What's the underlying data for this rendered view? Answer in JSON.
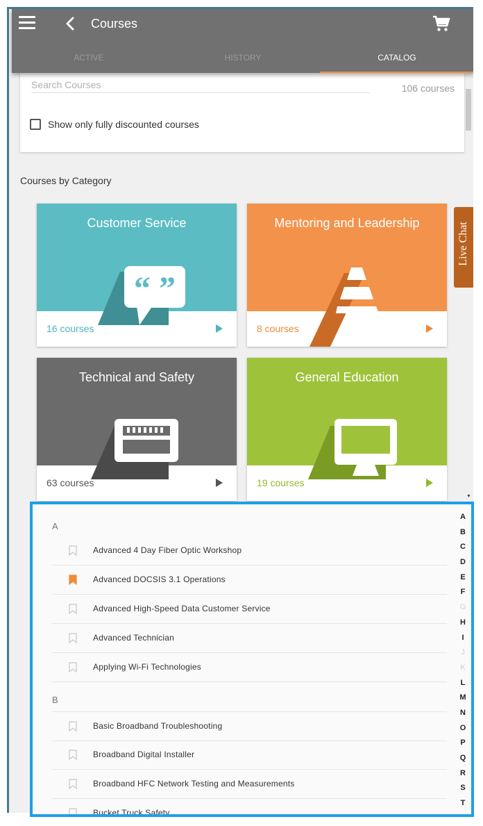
{
  "appbar": {
    "title": "Courses",
    "icons": [
      "menu-icon",
      "back-icon",
      "cart-icon"
    ],
    "tabs": [
      {
        "label": "ACTIVE",
        "active": false
      },
      {
        "label": "HISTORY",
        "active": false
      },
      {
        "label": "CATALOG",
        "active": true
      }
    ],
    "accent_color": "#f28c38"
  },
  "search": {
    "placeholder": "Search Courses",
    "value": "",
    "count_text": "106 courses",
    "discount_checkbox_label": "Show only fully discounted courses",
    "discount_checked": false
  },
  "categories": {
    "title": "Courses by Category",
    "tiles": [
      {
        "title": "Customer Service",
        "count": "16 courses",
        "color": "#5bbcc3",
        "count_color": "#4fb3bb",
        "icon": "speech-bubble-quote-icon"
      },
      {
        "title": "Mentoring and Leadership",
        "count": "8 courses",
        "color": "#f3924a",
        "count_color": "#ea8a3f",
        "icon": "pyramid-icon"
      },
      {
        "title": "Technical and Safety",
        "count": "63 courses",
        "color": "#6b6b6b",
        "count_color": "#555555",
        "icon": "circuit-board-icon"
      },
      {
        "title": "General Education",
        "count": "19 courses",
        "color": "#9ec33a",
        "count_color": "#93ba2c",
        "icon": "monitor-icon"
      }
    ]
  },
  "live_chat": {
    "label": "Live Chat",
    "color": "#b9621f"
  },
  "alphabetical": {
    "sections": [
      {
        "letter": "A",
        "items": [
          {
            "title": "Advanced 4 Day Fiber Optic Workshop",
            "bookmarked": false
          },
          {
            "title": "Advanced DOCSIS 3.1 Operations",
            "bookmarked": true
          },
          {
            "title": "Advanced High-Speed Data Customer Service",
            "bookmarked": false
          },
          {
            "title": "Advanced Technician",
            "bookmarked": false
          },
          {
            "title": "Applying Wi-Fi Technologies",
            "bookmarked": false
          }
        ]
      },
      {
        "letter": "B",
        "items": [
          {
            "title": "Basic Broadband Troubleshooting",
            "bookmarked": false
          },
          {
            "title": "Broadband Digital Installer",
            "bookmarked": false
          },
          {
            "title": "Broadband HFC Network Testing and Measurements",
            "bookmarked": false
          },
          {
            "title": "Bucket Truck Safety",
            "bookmarked": false
          }
        ]
      }
    ],
    "index_letters": [
      "A",
      "B",
      "C",
      "D",
      "E",
      "F",
      "G",
      "H",
      "I",
      "J",
      "K",
      "L",
      "M",
      "N",
      "O",
      "P",
      "Q",
      "R",
      "S",
      "T"
    ],
    "disabled_letters": [
      "G",
      "J",
      "K"
    ],
    "bookmark_active_color": "#f28c38",
    "highlight_border_color": "#1ea0e6"
  }
}
